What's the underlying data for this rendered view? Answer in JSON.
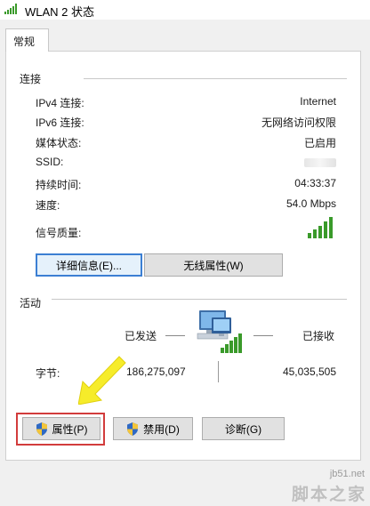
{
  "window": {
    "title": "WLAN 2 状态"
  },
  "tabs": [
    {
      "label": "常规"
    }
  ],
  "connection": {
    "heading": "连接",
    "rows": [
      {
        "label": "IPv4 连接:",
        "value": "Internet"
      },
      {
        "label": "IPv6 连接:",
        "value": "无网络访问权限"
      },
      {
        "label": "媒体状态:",
        "value": "已启用"
      },
      {
        "label": "SSID:",
        "value": ""
      },
      {
        "label": "持续时间:",
        "value": "04:33:37"
      },
      {
        "label": "速度:",
        "value": "54.0 Mbps"
      },
      {
        "label": "信号质量:",
        "value": ""
      }
    ],
    "signal_bars_filled": 5,
    "buttons": {
      "details": "详细信息(E)...",
      "wireless_props": "无线属性(W)"
    }
  },
  "activity": {
    "heading": "活动",
    "sent_label": "已发送",
    "received_label": "已接收",
    "bytes_label": "字节:",
    "bytes_sent": "186,275,097",
    "bytes_received": "45,035,505"
  },
  "bottom_buttons": {
    "properties": "属性(P)",
    "disable": "禁用(D)",
    "diagnose": "诊断(G)"
  },
  "watermark": {
    "site": "jb51.net",
    "name": "脚本之家"
  },
  "colors": {
    "focus_border": "#3c7fd3",
    "highlight_box": "#d23c3c",
    "arrow": "#f6ec2a",
    "signal_green": "#3a9a2a"
  },
  "icons": [
    "wifi-signal-icon",
    "network-computer-icon",
    "signal-strength-icon",
    "uac-shield-icon"
  ]
}
